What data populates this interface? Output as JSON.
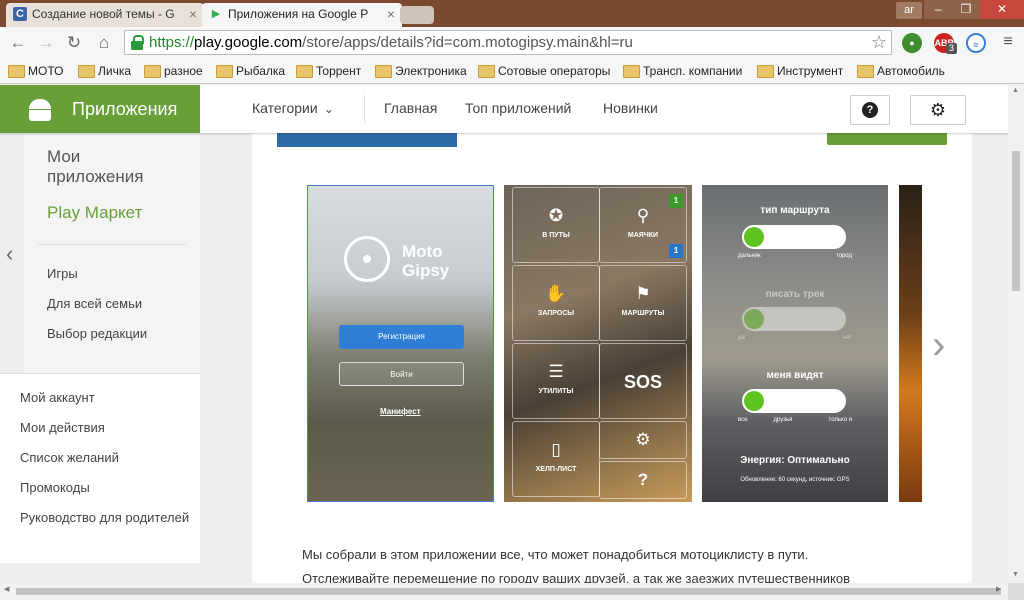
{
  "browser": {
    "tabs": [
      {
        "title": "Создание новой темы - G",
        "favicon": "C"
      },
      {
        "title": "Приложения на Google P",
        "favicon": "▶"
      }
    ],
    "user_badge": "ar",
    "url": {
      "scheme": "https://",
      "host": "play.google.com",
      "path": "/store/apps/details?id=com.motogipsy.main&hl=ru"
    },
    "extensions": [
      {
        "name": "ext-green"
      },
      {
        "name": "adblock",
        "label": "ABP",
        "badge": "3"
      },
      {
        "name": "ext-blue"
      }
    ],
    "bookmarks": [
      "МОТО",
      "Личка",
      "разное",
      "Рыбалка",
      "Торрент",
      "Электроника",
      "Сотовые операторы",
      "Трансп. компании",
      "Инструмент",
      "Автомобиль"
    ]
  },
  "header": {
    "apps_title": "Приложения",
    "categories": "Категории",
    "links": [
      "Главная",
      "Топ приложений",
      "Новинки"
    ],
    "help_icon": "?",
    "settings_icon": "⚙"
  },
  "sidebar": {
    "my_apps": "Мои приложения",
    "store": "Play Маркет",
    "items": [
      "Игры",
      "Для всей семьи",
      "Выбор редакции"
    ],
    "account_items": [
      "Мой аккаунт",
      "Мои действия",
      "Список желаний",
      "Промокоды",
      "Руководство для родителей"
    ]
  },
  "screenshots": {
    "s1": {
      "brand": "Moto Gipsy",
      "register": "Регистрация",
      "login": "Войти",
      "manifest": "Манифест"
    },
    "s2": {
      "tiles": [
        {
          "label": "В ПУТЫ",
          "icon": "✪"
        },
        {
          "label": "МАЯЧКИ",
          "icon": "⚲",
          "badge_top": "1",
          "badge_bottom": "1"
        },
        {
          "label": "ЗАПРОСЫ",
          "icon": "✋"
        },
        {
          "label": "МАРШРУТЫ",
          "icon": "⚑"
        },
        {
          "label": "УТИЛИТЫ",
          "icon": "☰"
        },
        {
          "label": "SOS",
          "icon": ""
        },
        {
          "label": "ХЕЛП-ЛИСТ",
          "icon": "▯"
        },
        {
          "label": "",
          "icon": "⚙"
        },
        {
          "label": "",
          "icon": "?"
        }
      ]
    },
    "s3": {
      "route_type": "тип маршрута",
      "route_left": "дальняк",
      "route_right": "город",
      "track": "писать трек",
      "track_left": "да",
      "track_right": "нет",
      "who_sees": "меня видят",
      "who_left": "все",
      "who_mid": "друзья",
      "who_right": "только я",
      "energy": "Энергия: Оптимально",
      "status": "Обновление: 60 секунд, источник: GPS"
    }
  },
  "description": {
    "line1": "Мы собрали в этом приложении все, что может понадобиться мотоциклисту в пути.",
    "line2": "Отслеживайте перемещение по городу ваших друзей, а так же заезжих путешественников"
  },
  "colors": {
    "accent_green": "#689f38",
    "blue_button": "#2e6aa6",
    "chrome_frame": "#7b4a2e"
  }
}
